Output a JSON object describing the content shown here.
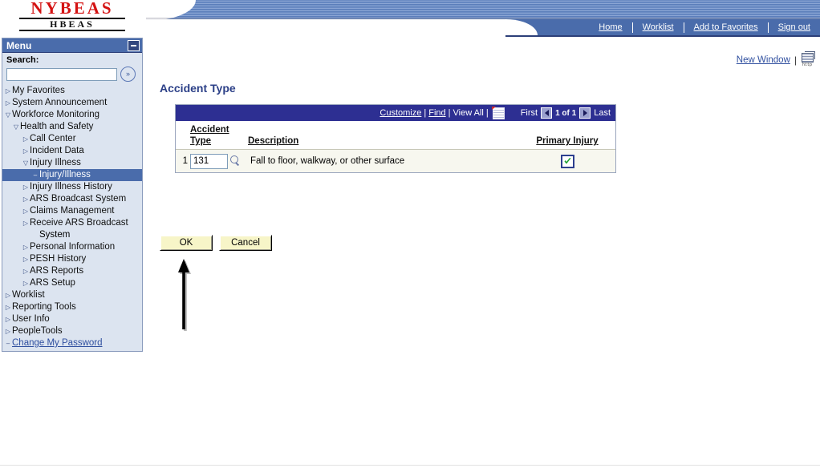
{
  "branding": {
    "logo_main": "NYBEAS",
    "logo_sub": "HBEAS"
  },
  "nav": {
    "links": [
      {
        "label": "Home",
        "name": "nav-home"
      },
      {
        "label": "Worklist",
        "name": "nav-worklist"
      },
      {
        "label": "Add to Favorites",
        "name": "nav-add-to-favorites"
      },
      {
        "label": "Sign out",
        "name": "nav-sign-out"
      }
    ]
  },
  "menu": {
    "title": "Menu",
    "collapse_icon": "minimize-icon",
    "search_label": "Search:",
    "search_value": "",
    "search_placeholder": "",
    "search_go_icon": "double-chevron-right-icon",
    "items": [
      {
        "label": "My Favorites",
        "indent": 0,
        "twisty": "collapsed",
        "selected": false,
        "link": false
      },
      {
        "label": "System Announcement",
        "indent": 0,
        "twisty": "collapsed",
        "selected": false,
        "link": false
      },
      {
        "label": "Workforce Monitoring",
        "indent": 0,
        "twisty": "expanded",
        "selected": false,
        "link": false
      },
      {
        "label": "Health and Safety",
        "indent": 1,
        "twisty": "expanded",
        "selected": false,
        "link": false
      },
      {
        "label": "Call Center",
        "indent": 2,
        "twisty": "collapsed",
        "selected": false,
        "link": false
      },
      {
        "label": "Incident Data",
        "indent": 2,
        "twisty": "collapsed",
        "selected": false,
        "link": false
      },
      {
        "label": "Injury Illness",
        "indent": 2,
        "twisty": "expanded",
        "selected": false,
        "link": false
      },
      {
        "label": "Injury/Illness",
        "indent": 3,
        "twisty": "leaf",
        "selected": true,
        "link": false
      },
      {
        "label": "Injury Illness History",
        "indent": 2,
        "twisty": "collapsed",
        "selected": false,
        "link": false
      },
      {
        "label": "ARS Broadcast System",
        "indent": 2,
        "twisty": "collapsed",
        "selected": false,
        "link": false
      },
      {
        "label": "Claims Management",
        "indent": 2,
        "twisty": "collapsed",
        "selected": false,
        "link": false
      },
      {
        "label": "Receive ARS Broadcast",
        "indent": 2,
        "twisty": "collapsed",
        "selected": false,
        "link": false,
        "wrap": "System"
      },
      {
        "label": "Personal Information",
        "indent": 2,
        "twisty": "collapsed",
        "selected": false,
        "link": false
      },
      {
        "label": "PESH History",
        "indent": 2,
        "twisty": "collapsed",
        "selected": false,
        "link": false
      },
      {
        "label": "ARS Reports",
        "indent": 2,
        "twisty": "collapsed",
        "selected": false,
        "link": false
      },
      {
        "label": "ARS Setup",
        "indent": 2,
        "twisty": "collapsed",
        "selected": false,
        "link": false
      },
      {
        "label": "Worklist",
        "indent": 0,
        "twisty": "collapsed",
        "selected": false,
        "link": false
      },
      {
        "label": "Reporting Tools",
        "indent": 0,
        "twisty": "collapsed",
        "selected": false,
        "link": false
      },
      {
        "label": "User Info",
        "indent": 0,
        "twisty": "collapsed",
        "selected": false,
        "link": false
      },
      {
        "label": "PeopleTools",
        "indent": 0,
        "twisty": "collapsed",
        "selected": false,
        "link": false
      },
      {
        "label": "Change My Password",
        "indent": 0,
        "twisty": "leaf",
        "selected": false,
        "link": true
      }
    ]
  },
  "toolbar": {
    "new_window": "New Window",
    "separator": "|",
    "http_icon": "http-page-icon",
    "http_icon_label": "http"
  },
  "main": {
    "page_title": "Accident Type"
  },
  "grid": {
    "customize": "Customize",
    "find": "Find",
    "view_all": "View All",
    "sep": "|",
    "download_icon": "spreadsheet-download-icon",
    "first": "First",
    "last": "Last",
    "page_indicator": "1 of 1",
    "prev_icon": "previous-page-icon",
    "next_icon": "next-page-icon",
    "columns": {
      "row_num": "",
      "accident_type_line1": "Accident",
      "accident_type_line2": "Type",
      "description": "Description",
      "primary_injury": "Primary Injury"
    },
    "rows": [
      {
        "num": "1",
        "accident_type": "131",
        "lookup_icon": "magnifier-lookup-icon",
        "description": "Fall to floor, walkway, or other surface",
        "primary_injury_checked": true
      }
    ]
  },
  "buttons": {
    "ok": "OK",
    "cancel": "Cancel"
  },
  "annotation": {
    "arrow": "up-arrow-annotation"
  },
  "colors": {
    "banner_blue": "#6d8cc6",
    "nav_blue": "#4a6cab",
    "grid_header_blue": "#2d2f92",
    "title_blue": "#2b3f87",
    "logo_red": "#d41212",
    "row_bg": "#f7f7ef",
    "button_yellow": "#f7f5c8",
    "menu_bg": "#dce4f0",
    "link_blue": "#2f4f9f"
  }
}
